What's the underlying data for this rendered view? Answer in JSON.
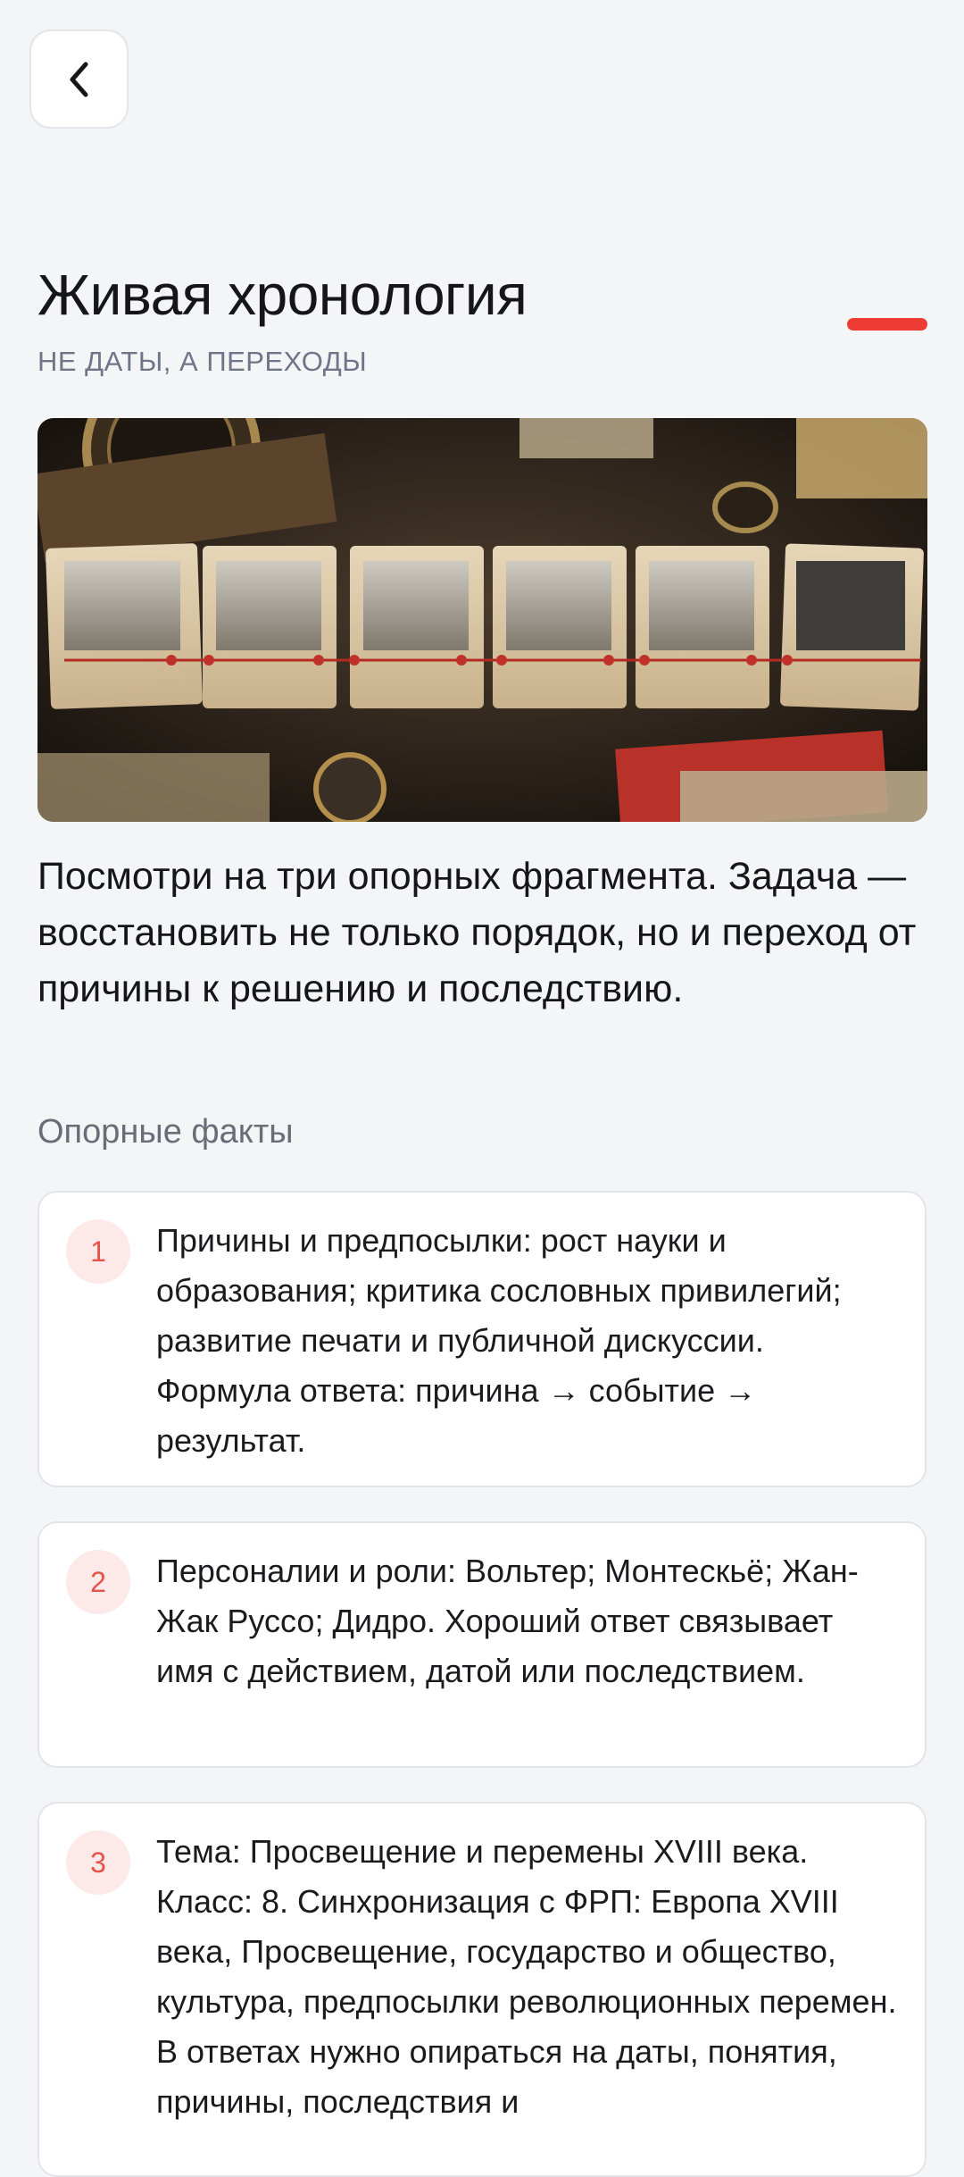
{
  "header": {
    "back_icon": "chevron-left-icon",
    "title": "Живая хронология",
    "subtitle": "НЕ ДАТЫ, А ПЕРЕХОДЫ",
    "accent_color": "#ee3b33"
  },
  "hero_image": {
    "alt": "timeline-cards-photo"
  },
  "intro_text": "Посмотри на три опорных фрагмента. Задача — восстановить не только порядок, но и переход от причины к решению и последствию.",
  "facts_section": {
    "label": "Опорные факты",
    "items": [
      {
        "number": "1",
        "text": "Причины и предпосылки: рост науки и образования; критика сословных привилегий; развитие печати и публичной дискуссии. Формула ответа: причина → событие → результат."
      },
      {
        "number": "2",
        "text": "Персоналии и роли: Вольтер; Монтескьё; Жан-Жак Руссо; Дидро. Хороший ответ связывает имя с действием, датой или последствием."
      },
      {
        "number": "3",
        "text": "Тема: Просвещение и перемены XVIII века. Класс: 8. Синхронизация с ФРП: Европа XVIII века, Просвещение, государство и общество, культура, предпосылки революционных перемен. В ответах нужно опираться на даты, понятия, причины, последствия и"
      }
    ]
  }
}
